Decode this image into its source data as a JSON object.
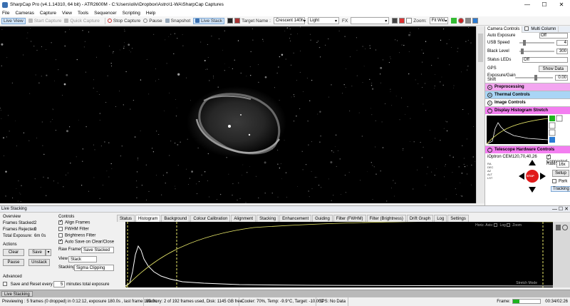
{
  "window": {
    "title": "SharpCap Pro (v4.1.14310, 64 bit) - ATR2600M - C:\\Users\\oliv\\Dropbox\\Astro\\1-WA\\SharpCap Captures",
    "controls": [
      "—",
      "☐",
      "✕"
    ]
  },
  "menu": [
    "File",
    "Cameras",
    "Capture",
    "View",
    "Tools",
    "Sequencer",
    "Scripting",
    "Help"
  ],
  "toolbar": {
    "live_view": "Live View",
    "start_capture": "Start Capture",
    "quick_capture": "Quick Capture",
    "stop_capture": "Stop Capture",
    "pause": "Pause",
    "snapshot": "Snapshot",
    "live_stack": "Live Stack",
    "target_name_label": "Target Name :",
    "target_name_value": "Crescent 140h",
    "light_value": "Light",
    "fx_label": "FX",
    "zoom_label": "Zoom:",
    "zoom_value": "Fit Wid"
  },
  "camera_panel": {
    "tabs": [
      "Camera Controls",
      "Multi Column"
    ],
    "auto_exposure_label": "Auto Exposure",
    "auto_exposure_value": "Off",
    "usb_speed_label": "USB Speed",
    "usb_speed_value": "4",
    "usb_speed_level": 0.1,
    "black_level_label": "Black Level",
    "black_level_value": "300",
    "black_level_level": 0.04,
    "status_leds_label": "Status LEDs",
    "status_leds_value": "Off",
    "gps_label": "GPS",
    "show_data_label": "Show Data",
    "exposure_gain_label": "Exposure/Gain Shift",
    "exposure_gain_value": "0.00",
    "exposure_gain_level": 0.5
  },
  "sections": {
    "preprocessing": "Preprocessing",
    "thermal": "Thermal Controls",
    "image": "Image Controls",
    "display_histogram": "Display Histogram Stretch",
    "telescope": "Telescope Hardware Controls"
  },
  "telescope": {
    "mount": "iOptron CEM120,70,40,26",
    "connected_label": "Connected",
    "rate_label": "Rate:",
    "rate_value": "16x",
    "setup_label": "Setup",
    "park_label": "Park",
    "stop_label": "STOP",
    "tracking_label": "Tracking",
    "readout": [
      "RA",
      "DEC",
      "AZ",
      "ALT",
      "LST"
    ]
  },
  "live_stacking": {
    "header": "Live Stacking",
    "overview_label": "Overview",
    "frames_stacked_label": "Frames Stacked:",
    "frames_stacked_value": "2",
    "frames_rejected_label": "Frames Rejected:",
    "frames_rejected_value": "0",
    "total_exposure_label": "Total Exposure:",
    "total_exposure_value": "6m 0s",
    "actions_label": "Actions",
    "clear_label": "Clear",
    "save_label": "Save",
    "pause_label": "Pause",
    "unstack_label": "Unstack",
    "advanced_label": "Advanced",
    "save_reset_label": "Save and Reset every",
    "save_reset_value": "5",
    "minutes_label": "minutes total exposure",
    "controls_label": "Controls",
    "align_frames": "Align Frames",
    "fwhm_filter": "FWHM Filter",
    "brightness_filter": "Brightness Filter",
    "auto_save": "Auto Save on Clear/Close",
    "raw_frames_label": "Raw Frames",
    "raw_frames_value": "Save Stacked",
    "view_label": "View",
    "view_value": "Stack",
    "stacking_label": "Stacking",
    "stacking_value": "Sigma Clipping",
    "tabs": [
      "Status",
      "Histogram",
      "Background",
      "Colour Calibration",
      "Alignment",
      "Stacking",
      "Enhancement",
      "Guiding",
      "Filter (FWHM)",
      "Filter (Brightness)",
      "Drift Graph",
      "Log",
      "Settings"
    ],
    "hist_options": "Horiz. Axis:",
    "hist_log": "Log",
    "hist_zoom": "Zoom",
    "stretch_mode": "Stretch Mode"
  },
  "bottom_tab": "Live Stacking",
  "status": {
    "previewing": "Previewing : 5 frames (0 dropped) in 0:12:12, exposure 180.0s , last frame 180.0s",
    "memory": "Memory: 2 of 192 frames used, Disk: 1145 GB free",
    "cooler": "Cooler: 70%, Temp: -9.9°C, Target: -10.0°C",
    "gps": "GPS: No Data",
    "frame_label": "Frame:",
    "frame_time": "00:34/02:26",
    "frame_progress": 0.24
  },
  "colors": {
    "section_pink": "#f3a6f0",
    "section_blue": "#a9d5f5",
    "section_magenta": "#f37ef0",
    "stop_red": "#e01b1b",
    "progress_green": "#1db31d",
    "histo_yellow": "#e9e96a"
  }
}
